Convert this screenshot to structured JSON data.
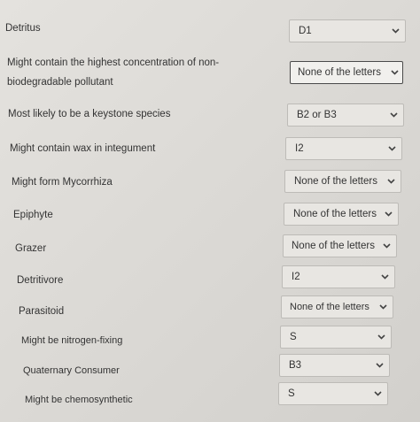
{
  "rows": [
    {
      "label": "Detritus",
      "value": "D1"
    },
    {
      "label_line1": "Might contain the highest concentration of non-",
      "label_line2": "biodegradable pollutant",
      "value": "None of the letters"
    },
    {
      "label": "Most likely to be a keystone species",
      "value": "B2 or B3"
    },
    {
      "label": "Might contain wax in integument",
      "value": "I2"
    },
    {
      "label": "Might form Mycorrhiza",
      "value": "None of the letters"
    },
    {
      "label": "Epiphyte",
      "value": "None of the letters"
    },
    {
      "label": "Grazer",
      "value": "None of the letters"
    },
    {
      "label": "Detritivore",
      "value": "I2"
    },
    {
      "label": "Parasitoid",
      "value": "None of the letters"
    },
    {
      "label": "Might be nitrogen-fixing",
      "value": "S"
    },
    {
      "label": "Quaternary Consumer",
      "value": "B3"
    },
    {
      "label": "Might be chemosynthetic",
      "value": "S"
    }
  ],
  "icons": {
    "dropdown": "chevron-down-icon"
  }
}
